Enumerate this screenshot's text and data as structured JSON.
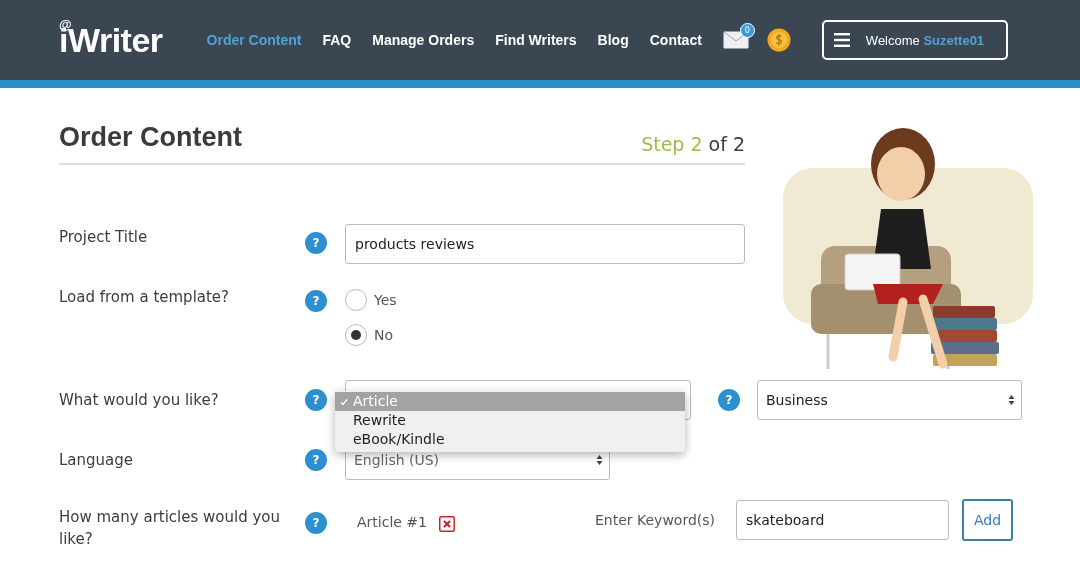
{
  "header": {
    "logo_at": "@",
    "logo": "iWriter",
    "nav": [
      {
        "label": "Order Content",
        "selected": true
      },
      {
        "label": "FAQ",
        "selected": false
      },
      {
        "label": "Manage Orders",
        "selected": false
      },
      {
        "label": "Find Writers",
        "selected": false
      },
      {
        "label": "Blog",
        "selected": false
      },
      {
        "label": "Contact",
        "selected": false
      }
    ],
    "mail_badge": "0",
    "welcome": "Welcome",
    "username": "Suzette01"
  },
  "page": {
    "title": "Order Content",
    "step_label": "Step 2",
    "step_of": "of 2"
  },
  "form": {
    "project_title": {
      "label": "Project Title",
      "help": "?",
      "value": "products reviews"
    },
    "template": {
      "label": "Load from a template?",
      "help": "?",
      "options": [
        {
          "label": "Yes",
          "selected": false
        },
        {
          "label": "No",
          "selected": true
        }
      ]
    },
    "type": {
      "label": "What would you like?",
      "help": "?",
      "open": true,
      "options": [
        {
          "label": "Article",
          "selected": true
        },
        {
          "label": "Rewrite",
          "selected": false
        },
        {
          "label": "eBook/Kindle",
          "selected": false
        }
      ],
      "category_help": "?",
      "category": "Business"
    },
    "language": {
      "label": "Language",
      "help": "?",
      "value": "English (US)"
    },
    "articles": {
      "label": "How many articles would you like?",
      "help": "?",
      "article": "Article #1",
      "keyword_label": "Enter Keyword(s)",
      "keyword": "skateboard",
      "add_button": "Add"
    }
  }
}
